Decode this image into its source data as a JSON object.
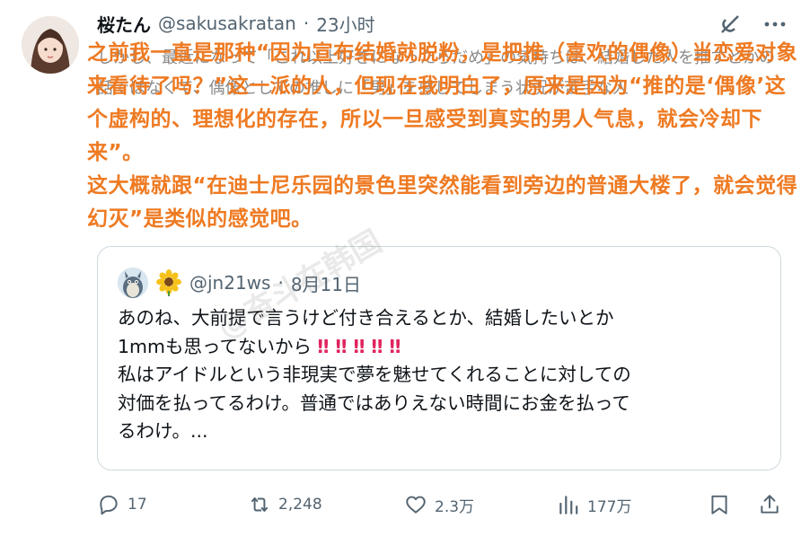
{
  "tweet": {
    "display_name": "桜たん",
    "handle": "@sakusakratan",
    "separator": "·",
    "time": "23小时",
    "ghost_text": "しかし、最近になって「これ以上好きになったらだめ」の気持ちは、結婚した人を推すとかの話ではなくて、偶像としての推しに「男」を感じてしまう状況が苦手な人"
  },
  "overlay_translation": {
    "line1": "之前我一直是那种“因为宣布结婚就脱粉，是把推（喜欢的偶像）当恋爱对象来看待了吗？”这一派的人，但现在我明白了，原来是因为“推的是‘偶像’这个虚构的、理想化的存在，所以一旦感受到真实的男人气息，就会冷却下来”。",
    "line2": "这大概就跟“在迪士尼乐园的景色里突然能看到旁边的普通大楼了，就会觉得幻灭”是类似的感觉吧。"
  },
  "quote": {
    "handle": "@jn21ws",
    "separator": "·",
    "date": "8月11日",
    "line1": "あのね、大前提で言うけど付き合えるとか、結婚したいとか",
    "line2_text": "1mmも思ってないから",
    "line2_bangs": "‼ ‼ ‼ ‼ ‼",
    "line3": "私はアイドルという非現実で夢を魅せてくれることに対しての",
    "line4": "対価を払ってるわけ。普通ではありえない時間にお金を払って",
    "line5": "るわけ。..."
  },
  "watermark": "@奋斗在韩国",
  "actions": {
    "replies": "17",
    "retweets": "2,248",
    "likes": "2.3万",
    "views": "177万"
  },
  "icons": {
    "reply": "reply-icon",
    "retweet": "retweet-icon",
    "like": "heart-icon",
    "views": "views-icon",
    "bookmark": "bookmark-icon",
    "share": "share-icon",
    "grok": "grok-icon",
    "more": "more-icon"
  },
  "colors": {
    "overlay_text": "#ee7a22",
    "secondary_text": "#536471",
    "border": "#cfd9de",
    "bangs": "#e0245e"
  }
}
